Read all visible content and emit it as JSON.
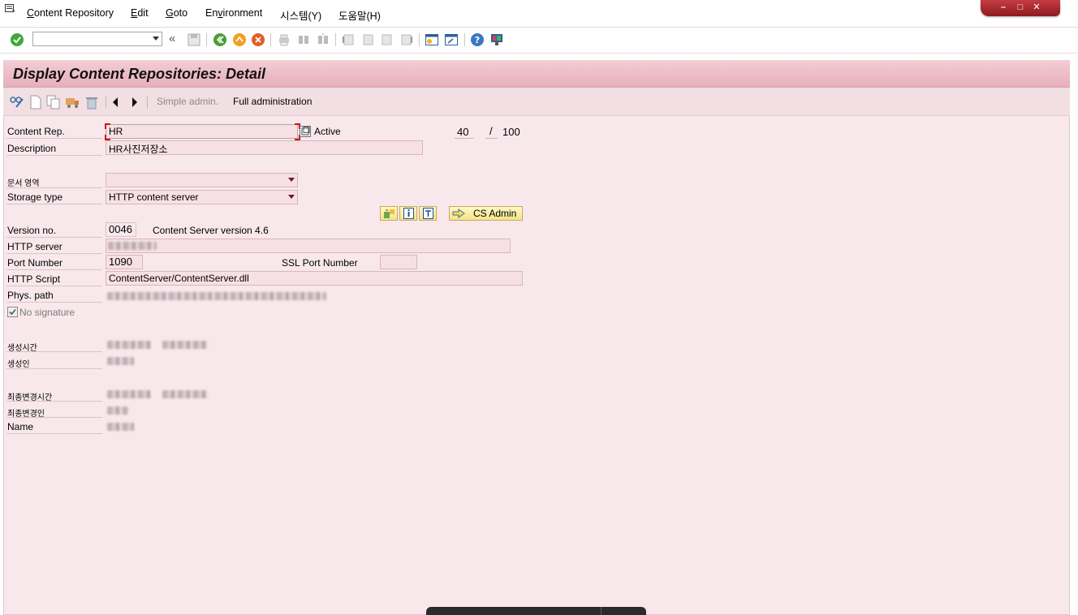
{
  "menu": {
    "items": [
      {
        "label": "Content Repository",
        "u": "C"
      },
      {
        "label": "Edit",
        "u": "E"
      },
      {
        "label": "Goto",
        "u": "G"
      },
      {
        "label": "Environment",
        "u": "v"
      },
      {
        "label": "시스템(Y)"
      },
      {
        "label": "도움말(H)"
      }
    ]
  },
  "toolbar": {
    "command_value": "",
    "icons": [
      "enter-icon",
      "back-double-icon",
      "save-icon",
      "back-icon",
      "exit-icon",
      "cancel-icon",
      "print-icon",
      "find-icon",
      "find-next-icon",
      "first-page-icon",
      "prev-page-icon",
      "next-page-icon",
      "last-page-icon",
      "new-session-icon",
      "shortcut-icon",
      "help-icon",
      "layout-icon"
    ]
  },
  "screen": {
    "title": "Display Content Repositories: Detail",
    "app_buttons": {
      "simple_admin": "Simple admin.",
      "full_admin": "Full administration"
    }
  },
  "form": {
    "content_rep_label": "Content Rep.",
    "content_rep_value": "HR",
    "active_label": "Active",
    "counter_current": "40",
    "counter_sep": "/",
    "counter_total": "100",
    "description_label": "Description",
    "description_value": "HR사진저장소",
    "doc_area_label": "문서 영역",
    "doc_area_value": "",
    "storage_type_label": "Storage type",
    "storage_type_value": "HTTP content server",
    "cs_admin_label": "CS Admin",
    "version_label": "Version no.",
    "version_value": "0046",
    "content_server_version": "Content Server version 4.6",
    "http_server_label": "HTTP server",
    "port_label": "Port Number",
    "port_value": "1090",
    "ssl_port_label": "SSL Port Number",
    "ssl_port_value": "",
    "http_script_label": "HTTP Script",
    "http_script_value": "ContentServer/ContentServer.dll",
    "phys_path_label": "Phys. path",
    "no_signature_label": "No signature",
    "created_time_label": "생성시간",
    "creator_label": "생성인",
    "last_changed_time_label": "최종변경시간",
    "last_changed_by_label": "최종변경인",
    "name_label": "Name"
  },
  "colors": {
    "screen_bg": "#f8e8ec",
    "title_bg": "#e9b6c1",
    "field_bg": "#f7e0e5",
    "window_controls": "#b0282e"
  }
}
